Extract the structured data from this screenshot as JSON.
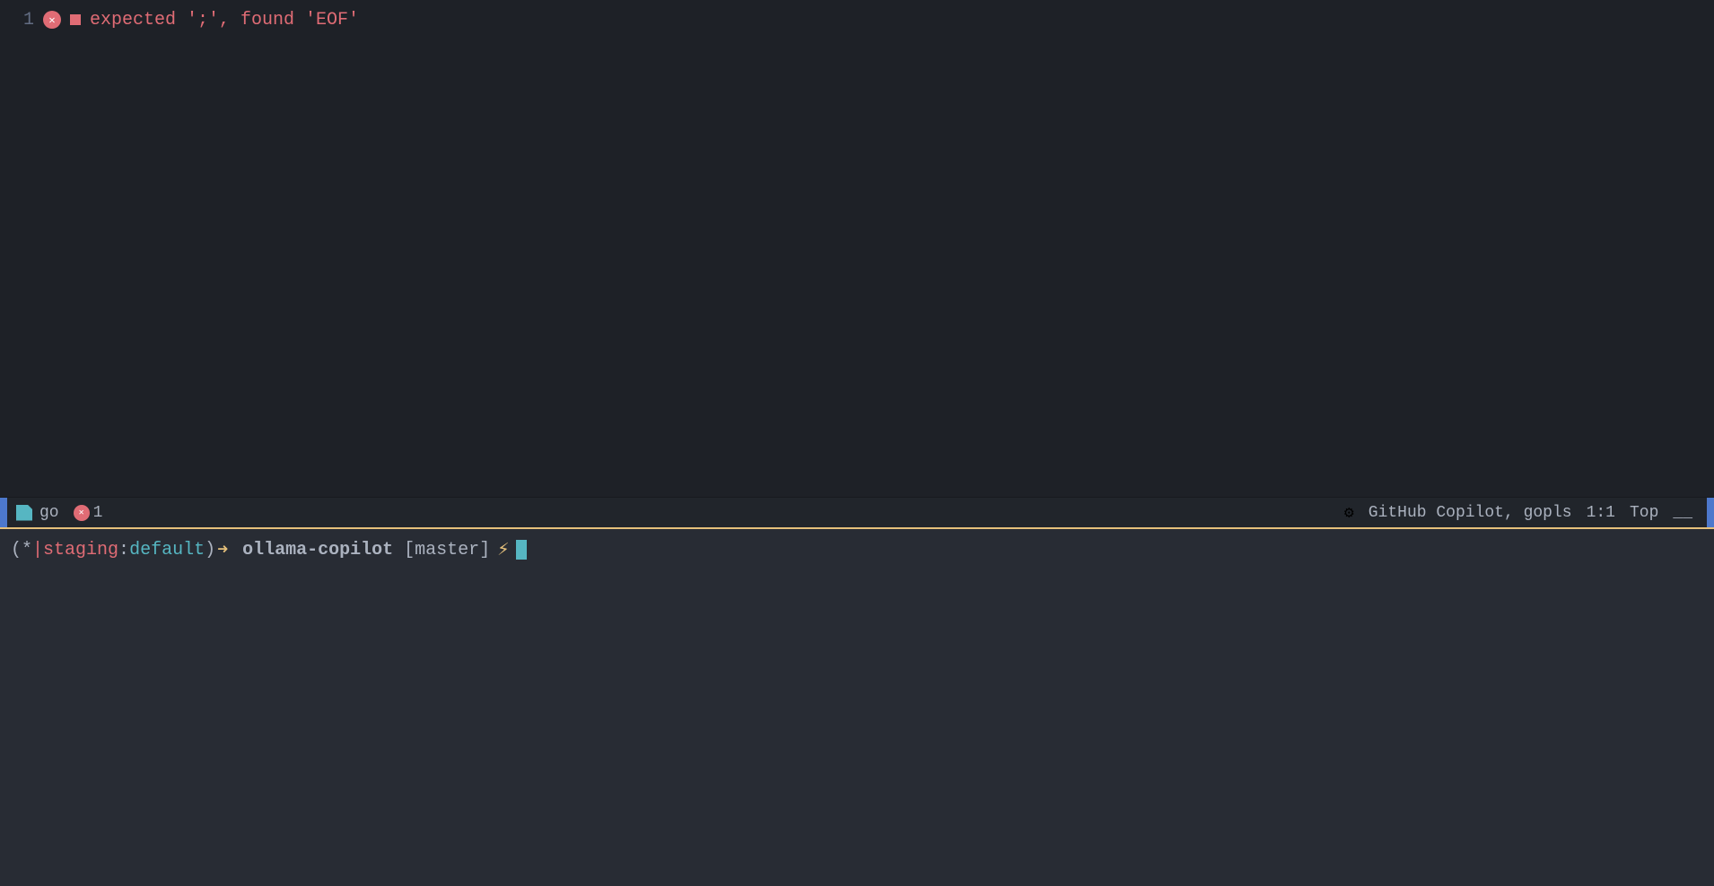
{
  "editor": {
    "background_color": "#1e2127",
    "error_line": {
      "line_number": "1",
      "error_message": "expected ';', found 'EOF'"
    }
  },
  "status_bar": {
    "background_color": "#21252b",
    "accent_color": "#4d78cc",
    "file_icon_color": "#56b6c2",
    "filename": "go",
    "error_count": "1",
    "copilot_text": "GitHub Copilot, gopls",
    "position": "1:1",
    "position_top": "Top",
    "separator": "   "
  },
  "terminal": {
    "background_color": "#282c34",
    "border_color": "#e5c07b",
    "prompt": {
      "bracket_left": "(*",
      "pipe": "|",
      "context": "staging",
      "colon": ":",
      "namespace": "default",
      "bracket_right": ")",
      "arrow": "➜",
      "project": "ollama-copilot",
      "branch": "[master]",
      "lightning": "⚡"
    }
  }
}
